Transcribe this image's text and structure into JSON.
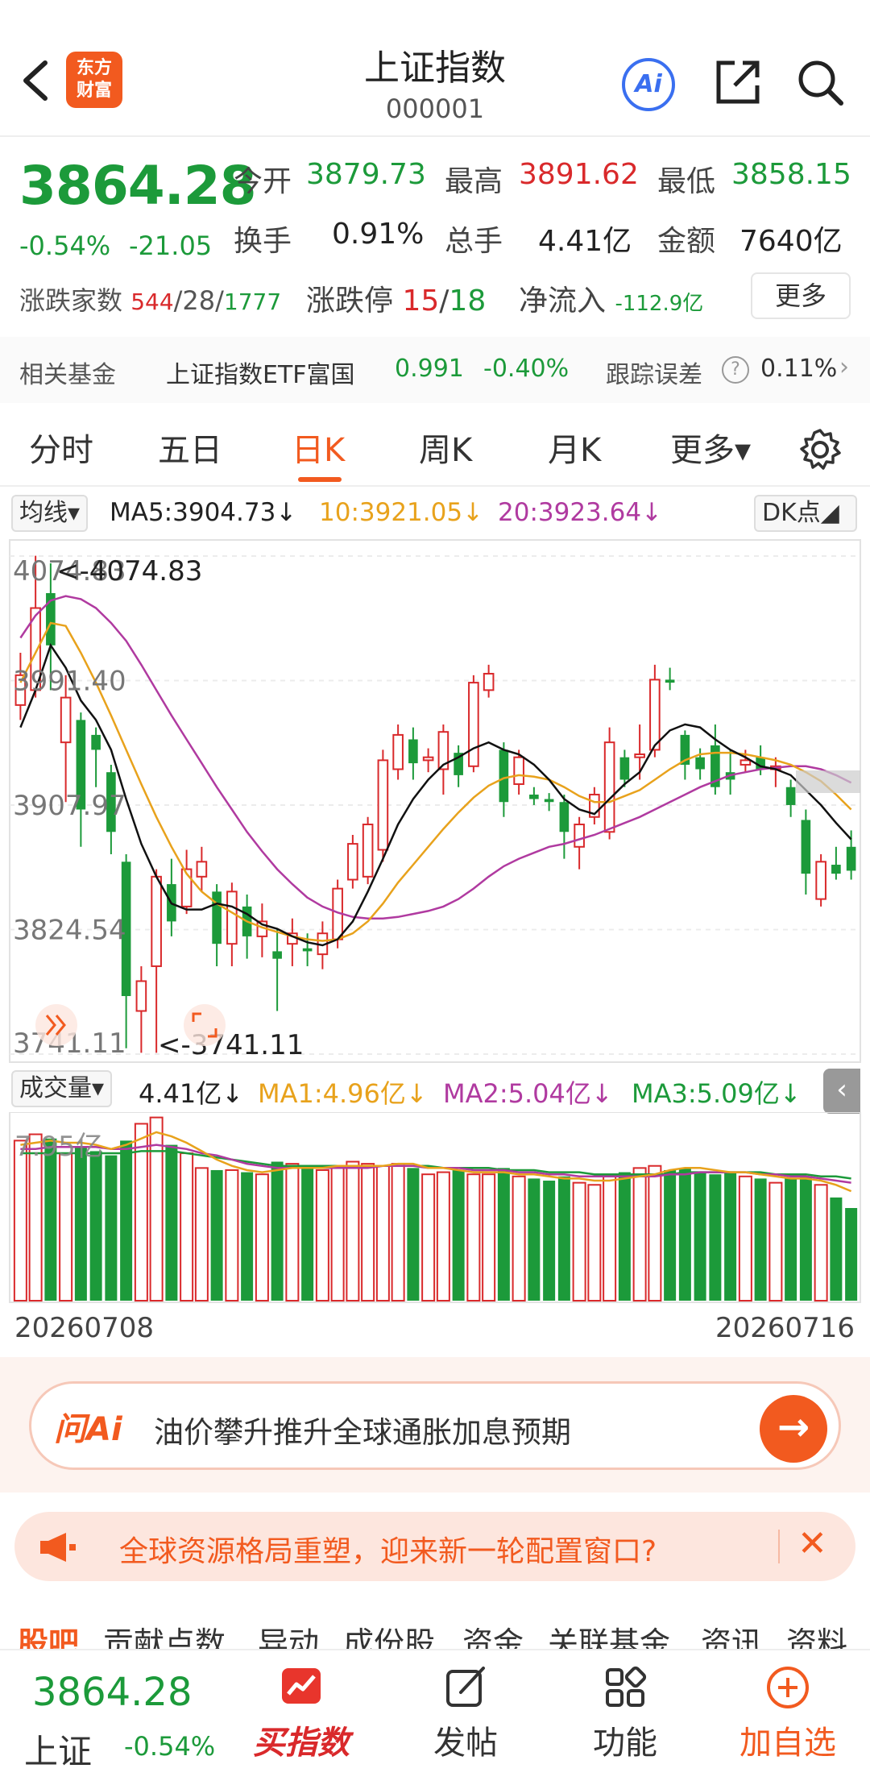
{
  "header": {
    "title": "上证指数",
    "code": "000001",
    "logo_line1": "东方",
    "logo_line2": "财富",
    "ai_label": "Ai"
  },
  "quote": {
    "price": "3864.28",
    "change_pct": "-0.54%",
    "change_val": "-21.05",
    "open_label": "今开",
    "open": "3879.73",
    "high_label": "最高",
    "high": "3891.62",
    "low_label": "最低",
    "low": "3858.15",
    "turnover_label": "换手",
    "turnover": "0.91%",
    "volume_label": "总手",
    "volume": "4.41亿",
    "amount_label": "金额",
    "amount": "7640亿",
    "breadth_label": "涨跌家数",
    "breadth_up": "544",
    "breadth_flat": "28",
    "breadth_down": "1777",
    "limit_label": "涨跌停",
    "limit_up": "15",
    "limit_down": "18",
    "netflow_label": "净流入",
    "netflow": "-112.9亿",
    "more_label": "更多",
    "slash": "/"
  },
  "fund": {
    "label": "相关基金",
    "name": "上证指数ETF富国",
    "price": "0.991",
    "change": "-0.40%",
    "track_label": "跟踪误差",
    "help": "?",
    "track_value": "0.11%",
    "chevron": "›"
  },
  "tabs": [
    {
      "label": "分时"
    },
    {
      "label": "五日"
    },
    {
      "label": "日K"
    },
    {
      "label": "周K"
    },
    {
      "label": "月K"
    },
    {
      "label": "更多▾"
    }
  ],
  "ma_row": {
    "select": "均线▾",
    "ma5": "MA5:3904.73↓",
    "ma10": "10:3921.05↓",
    "ma20": "20:3923.64↓",
    "dk": "DK点◢"
  },
  "kline": {
    "y_labels": [
      "4074.83",
      "3991.40",
      "3907.97",
      "3824.54",
      "3741.11"
    ],
    "max_annotation": "<-4074.83",
    "min_annotation": "<-3741.11"
  },
  "volume": {
    "select": "成交量▾",
    "value": "4.41亿↓",
    "ma1": "MA1:4.96亿↓",
    "ma2": "MA2:5.04亿↓",
    "ma3": "MA3:5.09亿↓",
    "y_label": "7.95亿",
    "collapse": "‹"
  },
  "dates": {
    "start": "20260708",
    "end": "20260716"
  },
  "ai_bar": {
    "badge": "问Ai",
    "text": "油价攀升推升全球通胀加息预期",
    "go": "→"
  },
  "notice": {
    "text": "全球资源格局重塑，迎来新一轮配置窗口?",
    "close": "✕"
  },
  "sub_tabs": [
    "股吧",
    "贡献点数",
    "异动",
    "成份股",
    "资金",
    "关联基金",
    "资讯",
    "资料"
  ],
  "bottom_nav": {
    "price": "3864.28",
    "name": "上证",
    "pct": "-0.54%",
    "items": [
      {
        "label": "买指数"
      },
      {
        "label": "发帖"
      },
      {
        "label": "功能"
      },
      {
        "label": "加自选"
      }
    ]
  },
  "colors": {
    "up": "#d9292b",
    "down": "#1c9a3a",
    "accent": "#f25a1f",
    "ma5": "#111111",
    "ma10": "#e8a21c",
    "ma20": "#b03aa0"
  },
  "chart_data": {
    "type": "candlestick",
    "ylim": [
      3741.11,
      4074.83
    ],
    "y_ticks": [
      3741.11,
      3824.54,
      3907.97,
      3991.4,
      4074.83
    ],
    "candles": [
      {
        "o": 3975,
        "c": 3995,
        "h": 4010,
        "l": 3965
      },
      {
        "o": 3985,
        "c": 4040,
        "h": 4075,
        "l": 3980
      },
      {
        "o": 4050,
        "c": 4015,
        "h": 4070,
        "l": 3985
      },
      {
        "o": 3950,
        "c": 3980,
        "h": 3995,
        "l": 3910
      },
      {
        "o": 3965,
        "c": 3905,
        "h": 3970,
        "l": 3880
      },
      {
        "o": 3955,
        "c": 3945,
        "h": 3960,
        "l": 3920
      },
      {
        "o": 3930,
        "c": 3890,
        "h": 3935,
        "l": 3875
      },
      {
        "o": 3870,
        "c": 3780,
        "h": 3875,
        "l": 3745
      },
      {
        "o": 3770,
        "c": 3790,
        "h": 3800,
        "l": 3742
      },
      {
        "o": 3800,
        "c": 3860,
        "h": 3865,
        "l": 3742
      },
      {
        "o": 3855,
        "c": 3830,
        "h": 3872,
        "l": 3820
      },
      {
        "o": 3840,
        "c": 3865,
        "h": 3878,
        "l": 3835
      },
      {
        "o": 3860,
        "c": 3870,
        "h": 3880,
        "l": 3850
      },
      {
        "o": 3850,
        "c": 3815,
        "h": 3855,
        "l": 3800
      },
      {
        "o": 3815,
        "c": 3850,
        "h": 3856,
        "l": 3800
      },
      {
        "o": 3840,
        "c": 3820,
        "h": 3848,
        "l": 3805
      },
      {
        "o": 3820,
        "c": 3830,
        "h": 3842,
        "l": 3806
      },
      {
        "o": 3810,
        "c": 3805,
        "h": 3825,
        "l": 3770
      },
      {
        "o": 3815,
        "c": 3822,
        "h": 3832,
        "l": 3800
      },
      {
        "o": 3812,
        "c": 3810,
        "h": 3822,
        "l": 3800
      },
      {
        "o": 3808,
        "c": 3822,
        "h": 3830,
        "l": 3798
      },
      {
        "o": 3818,
        "c": 3852,
        "h": 3858,
        "l": 3812
      },
      {
        "o": 3858,
        "c": 3882,
        "h": 3888,
        "l": 3852
      },
      {
        "o": 3860,
        "c": 3895,
        "h": 3900,
        "l": 3855
      },
      {
        "o": 3878,
        "c": 3938,
        "h": 3945,
        "l": 3870
      },
      {
        "o": 3932,
        "c": 3955,
        "h": 3962,
        "l": 3925
      },
      {
        "o": 3952,
        "c": 3936,
        "h": 3960,
        "l": 3925
      },
      {
        "o": 3938,
        "c": 3940,
        "h": 3946,
        "l": 3930
      },
      {
        "o": 3932,
        "c": 3957,
        "h": 3962,
        "l": 3915
      },
      {
        "o": 3943,
        "c": 3928,
        "h": 3948,
        "l": 3920
      },
      {
        "o": 3934,
        "c": 3990,
        "h": 3995,
        "l": 3930
      },
      {
        "o": 3985,
        "c": 3996,
        "h": 4002,
        "l": 3980
      },
      {
        "o": 3945,
        "c": 3910,
        "h": 3950,
        "l": 3900
      },
      {
        "o": 3922,
        "c": 3940,
        "h": 3945,
        "l": 3915
      },
      {
        "o": 3915,
        "c": 3912,
        "h": 3920,
        "l": 3908
      },
      {
        "o": 3912,
        "c": 3910,
        "h": 3916,
        "l": 3904
      },
      {
        "o": 3910,
        "c": 3890,
        "h": 3915,
        "l": 3872
      },
      {
        "o": 3880,
        "c": 3895,
        "h": 3900,
        "l": 3865
      },
      {
        "o": 3900,
        "c": 3915,
        "h": 3920,
        "l": 3895
      },
      {
        "o": 3890,
        "c": 3950,
        "h": 3960,
        "l": 3885
      },
      {
        "o": 3940,
        "c": 3925,
        "h": 3945,
        "l": 3920
      },
      {
        "o": 3940,
        "c": 3942,
        "h": 3962,
        "l": 3925
      },
      {
        "o": 3945,
        "c": 3992,
        "h": 4002,
        "l": 3940
      },
      {
        "o": 3992,
        "c": 3990,
        "h": 4000,
        "l": 3985
      },
      {
        "o": 3955,
        "c": 3935,
        "h": 3958,
        "l": 3925
      },
      {
        "o": 3940,
        "c": 3932,
        "h": 3946,
        "l": 3925
      },
      {
        "o": 3948,
        "c": 3920,
        "h": 3962,
        "l": 3915
      },
      {
        "o": 3930,
        "c": 3925,
        "h": 3945,
        "l": 3915
      },
      {
        "o": 3935,
        "c": 3938,
        "h": 3945,
        "l": 3930
      },
      {
        "o": 3940,
        "c": 3932,
        "h": 3948,
        "l": 3928
      },
      {
        "o": 3932,
        "c": 3934,
        "h": 3940,
        "l": 3920
      },
      {
        "o": 3920,
        "c": 3908,
        "h": 3925,
        "l": 3900
      },
      {
        "o": 3898,
        "c": 3862,
        "h": 3905,
        "l": 3848
      },
      {
        "o": 3845,
        "c": 3870,
        "h": 3875,
        "l": 3840
      },
      {
        "o": 3868,
        "c": 3862,
        "h": 3880,
        "l": 3858
      },
      {
        "o": 3880,
        "c": 3864,
        "h": 3891,
        "l": 3858
      }
    ],
    "ma5": [
      3960,
      3985,
      4015,
      4000,
      3978,
      3965,
      3945,
      3912,
      3882,
      3860,
      3842,
      3838,
      3838,
      3842,
      3840,
      3835,
      3828,
      3825,
      3820,
      3816,
      3814,
      3818,
      3830,
      3850,
      3872,
      3895,
      3912,
      3925,
      3935,
      3940,
      3946,
      3950,
      3945,
      3942,
      3935,
      3925,
      3912,
      3905,
      3902,
      3912,
      3922,
      3930,
      3948,
      3958,
      3962,
      3960,
      3952,
      3945,
      3940,
      3934,
      3932,
      3928,
      3918,
      3908,
      3896,
      3885
    ],
    "ma10": [
      3990,
      4010,
      4030,
      4028,
      4010,
      3990,
      3968,
      3945,
      3922,
      3900,
      3880,
      3862,
      3850,
      3842,
      3836,
      3830,
      3826,
      3823,
      3820,
      3818,
      3817,
      3818,
      3822,
      3830,
      3842,
      3856,
      3868,
      3880,
      3892,
      3903,
      3913,
      3921,
      3926,
      3928,
      3927,
      3925,
      3920,
      3914,
      3910,
      3910,
      3914,
      3918,
      3925,
      3932,
      3938,
      3942,
      3943,
      3943,
      3942,
      3940,
      3938,
      3935,
      3930,
      3924,
      3915,
      3905
    ],
    "ma20": [
      4020,
      4035,
      4045,
      4048,
      4046,
      4040,
      4030,
      4018,
      4002,
      3985,
      3968,
      3952,
      3936,
      3920,
      3905,
      3890,
      3877,
      3865,
      3855,
      3846,
      3840,
      3836,
      3833,
      3832,
      3832,
      3833,
      3835,
      3837,
      3840,
      3845,
      3852,
      3860,
      3867,
      3872,
      3876,
      3880,
      3882,
      3885,
      3888,
      3892,
      3896,
      3900,
      3905,
      3910,
      3915,
      3920,
      3924,
      3928,
      3930,
      3932,
      3933,
      3934,
      3934,
      3932,
      3928,
      3923
    ],
    "volume_ylim": [
      0,
      8.8
    ],
    "volumes": [
      7.6,
      7.9,
      7.7,
      7.0,
      7.3,
      7.1,
      6.9,
      7.6,
      8.4,
      8.7,
      7.4,
      7.0,
      6.3,
      6.2,
      6.2,
      6.1,
      6.0,
      6.6,
      6.5,
      6.3,
      6.2,
      6.3,
      6.6,
      6.5,
      6.4,
      6.5,
      6.3,
      6.0,
      6.1,
      6.2,
      6.0,
      6.0,
      6.3,
      5.9,
      5.8,
      5.7,
      5.9,
      5.6,
      5.5,
      5.9,
      6.1,
      6.3,
      6.4,
      6.2,
      6.3,
      6.1,
      6.0,
      6.1,
      5.9,
      5.8,
      5.6,
      5.8,
      5.9,
      5.5,
      4.9,
      4.4
    ],
    "vma1": [
      7.4,
      7.5,
      7.6,
      7.5,
      7.5,
      7.4,
      7.2,
      7.4,
      7.7,
      8.0,
      7.8,
      7.5,
      7.1,
      6.7,
      6.4,
      6.2,
      6.1,
      6.2,
      6.3,
      6.3,
      6.3,
      6.4,
      6.4,
      6.4,
      6.4,
      6.5,
      6.5,
      6.3,
      6.3,
      6.2,
      6.1,
      6.1,
      6.1,
      6.0,
      6.0,
      5.9,
      5.8,
      5.8,
      5.7,
      5.7,
      5.8,
      5.9,
      6.0,
      6.2,
      6.3,
      6.3,
      6.2,
      6.1,
      6.1,
      6.0,
      5.9,
      5.8,
      5.8,
      5.7,
      5.5,
      5.2
    ],
    "vma2": [
      7.2,
      7.2,
      7.3,
      7.3,
      7.3,
      7.3,
      7.2,
      7.2,
      7.3,
      7.4,
      7.3,
      7.2,
      7.0,
      6.9,
      6.7,
      6.5,
      6.4,
      6.3,
      6.3,
      6.3,
      6.3,
      6.3,
      6.3,
      6.3,
      6.4,
      6.4,
      6.4,
      6.3,
      6.3,
      6.3,
      6.2,
      6.2,
      6.2,
      6.1,
      6.1,
      6.0,
      6.0,
      5.9,
      5.9,
      5.9,
      5.9,
      5.9,
      5.9,
      6.0,
      6.0,
      6.1,
      6.1,
      6.1,
      6.1,
      6.0,
      6.0,
      5.9,
      5.9,
      5.8,
      5.7,
      5.6
    ],
    "vma3": [
      7.0,
      7.0,
      7.0,
      7.0,
      7.0,
      7.0,
      7.0,
      7.0,
      7.1,
      7.1,
      7.1,
      7.0,
      6.9,
      6.8,
      6.7,
      6.6,
      6.5,
      6.4,
      6.4,
      6.4,
      6.4,
      6.4,
      6.4,
      6.4,
      6.4,
      6.4,
      6.4,
      6.4,
      6.3,
      6.3,
      6.3,
      6.3,
      6.2,
      6.2,
      6.2,
      6.1,
      6.1,
      6.1,
      6.0,
      6.0,
      6.0,
      6.0,
      6.0,
      6.0,
      6.1,
      6.1,
      6.1,
      6.1,
      6.1,
      6.1,
      6.0,
      6.0,
      6.0,
      5.9,
      5.9,
      5.8
    ]
  }
}
